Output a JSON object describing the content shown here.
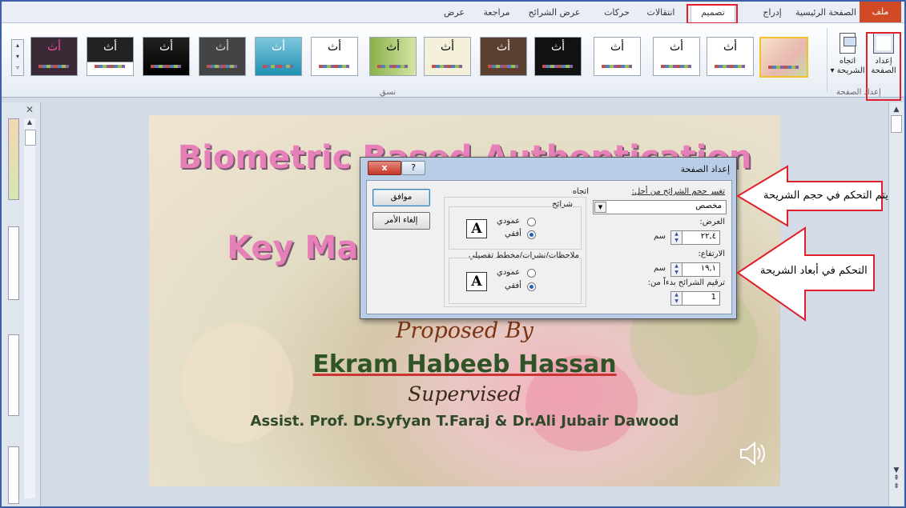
{
  "ribbon_tabs": {
    "file": "ملف",
    "home": "الصفحة الرئيسية",
    "insert": "إدراج",
    "design": "تصميم",
    "transitions": "انتقالات",
    "animations": "حركات",
    "slideshow": "عرض الشرائح",
    "review": "مراجعة",
    "view": "عرض"
  },
  "ribbon": {
    "page_setup_label": "إعداد الصفحة",
    "orientation_label": "اتجاه الشريحة",
    "page_setup_group": "إعداد الصفحة",
    "themes_group": "نسق",
    "theme_glyph": "أث"
  },
  "slide": {
    "title_line1": "Biometric Based Authentication",
    "title_line2": "Key Management Protocol",
    "proposed_by": "Proposed By",
    "author": "Ekram Habeeb Hassan",
    "supervised": "Supervised",
    "supervisors": "Assist. Prof. Dr.Syfyan T.Faraj & Dr.Ali Jubair Dawood"
  },
  "dialog": {
    "title": "إعداد الصفحة",
    "help": "?",
    "close": "x",
    "size_label": "تغيير حجم الشرائح من أجل:",
    "size_value": "مخصص",
    "width_label": "العرض:",
    "width_value": "٢٢,٤",
    "width_unit": "سم",
    "height_label": "الارتفاع:",
    "height_value": "١٩,١",
    "height_unit": "سم",
    "number_label": "ترقيم الشرائح بدءاً من:",
    "number_value": "1",
    "orientation_title": "اتجاه",
    "slides_group": "شرائح",
    "notes_group": "ملاحظات/نشرات/مخطط تفصيلي",
    "portrait": "عمودي",
    "landscape": "أفقي",
    "ok": "موافق",
    "cancel": "إلغاء الأمر"
  },
  "callouts": {
    "size_note": "يتم التحكم في حجم الشريحة",
    "dims_note": "التحكم في أبعاد الشريحة"
  },
  "colors": {
    "accent_red": "#e0202a",
    "file_tab": "#d04a26",
    "title_pink": "#e77fb8",
    "author_green": "#2e5427"
  }
}
